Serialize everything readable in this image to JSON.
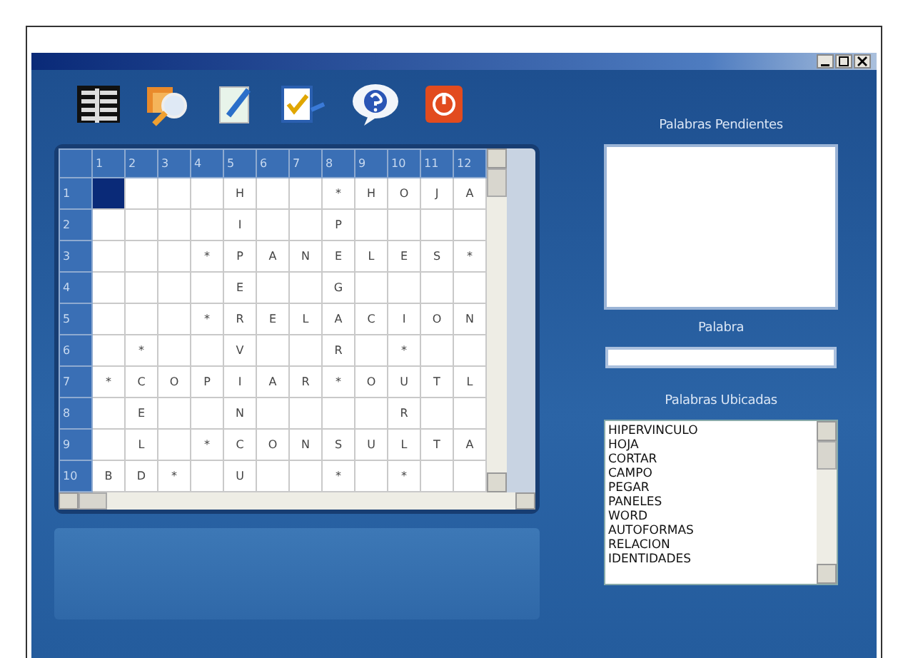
{
  "toolbar": [
    {
      "kind": "grid"
    },
    {
      "kind": "search"
    },
    {
      "kind": "edit"
    },
    {
      "kind": "check"
    },
    {
      "kind": "help"
    },
    {
      "kind": "power"
    }
  ],
  "grid": {
    "columns": [
      "1",
      "2",
      "3",
      "4",
      "5",
      "6",
      "7",
      "8",
      "9",
      "10",
      "11",
      "12"
    ],
    "rows": [
      {
        "header": "1",
        "cells": [
          {
            "text": "",
            "selected": true
          },
          {
            "text": "",
            "selected": false
          },
          {
            "text": "",
            "selected": false
          },
          {
            "text": "",
            "selected": false
          },
          {
            "text": "H",
            "selected": false
          },
          {
            "text": "",
            "selected": false
          },
          {
            "text": "",
            "selected": false
          },
          {
            "text": "*",
            "selected": false
          },
          {
            "text": "H",
            "selected": false
          },
          {
            "text": "O",
            "selected": false
          },
          {
            "text": "J",
            "selected": false
          },
          {
            "text": "A",
            "selected": false
          }
        ]
      },
      {
        "header": "2",
        "cells": [
          {
            "text": "",
            "selected": false
          },
          {
            "text": "",
            "selected": false
          },
          {
            "text": "",
            "selected": false
          },
          {
            "text": "",
            "selected": false
          },
          {
            "text": "I",
            "selected": false
          },
          {
            "text": "",
            "selected": false
          },
          {
            "text": "",
            "selected": false
          },
          {
            "text": "P",
            "selected": false
          },
          {
            "text": "",
            "selected": false
          },
          {
            "text": "",
            "selected": false
          },
          {
            "text": "",
            "selected": false
          },
          {
            "text": "",
            "selected": false
          }
        ]
      },
      {
        "header": "3",
        "cells": [
          {
            "text": "",
            "selected": false
          },
          {
            "text": "",
            "selected": false
          },
          {
            "text": "",
            "selected": false
          },
          {
            "text": "*",
            "selected": false
          },
          {
            "text": "P",
            "selected": false
          },
          {
            "text": "A",
            "selected": false
          },
          {
            "text": "N",
            "selected": false
          },
          {
            "text": "E",
            "selected": false
          },
          {
            "text": "L",
            "selected": false
          },
          {
            "text": "E",
            "selected": false
          },
          {
            "text": "S",
            "selected": false
          },
          {
            "text": "*",
            "selected": false
          }
        ]
      },
      {
        "header": "4",
        "cells": [
          {
            "text": "",
            "selected": false
          },
          {
            "text": "",
            "selected": false
          },
          {
            "text": "",
            "selected": false
          },
          {
            "text": "",
            "selected": false
          },
          {
            "text": "E",
            "selected": false
          },
          {
            "text": "",
            "selected": false
          },
          {
            "text": "",
            "selected": false
          },
          {
            "text": "G",
            "selected": false
          },
          {
            "text": "",
            "selected": false
          },
          {
            "text": "",
            "selected": false
          },
          {
            "text": "",
            "selected": false
          },
          {
            "text": "",
            "selected": false
          }
        ]
      },
      {
        "header": "5",
        "cells": [
          {
            "text": "",
            "selected": false
          },
          {
            "text": "",
            "selected": false
          },
          {
            "text": "",
            "selected": false
          },
          {
            "text": "*",
            "selected": false
          },
          {
            "text": "R",
            "selected": false
          },
          {
            "text": "E",
            "selected": false
          },
          {
            "text": "L",
            "selected": false
          },
          {
            "text": "A",
            "selected": false
          },
          {
            "text": "C",
            "selected": false
          },
          {
            "text": "I",
            "selected": false
          },
          {
            "text": "O",
            "selected": false
          },
          {
            "text": "N",
            "selected": false
          }
        ]
      },
      {
        "header": "6",
        "cells": [
          {
            "text": "",
            "selected": false
          },
          {
            "text": "*",
            "selected": false
          },
          {
            "text": "",
            "selected": false
          },
          {
            "text": "",
            "selected": false
          },
          {
            "text": "V",
            "selected": false
          },
          {
            "text": "",
            "selected": false
          },
          {
            "text": "",
            "selected": false
          },
          {
            "text": "R",
            "selected": false
          },
          {
            "text": "",
            "selected": false
          },
          {
            "text": "*",
            "selected": false
          },
          {
            "text": "",
            "selected": false
          },
          {
            "text": "",
            "selected": false
          }
        ]
      },
      {
        "header": "7",
        "cells": [
          {
            "text": "*",
            "selected": false
          },
          {
            "text": "C",
            "selected": false
          },
          {
            "text": "O",
            "selected": false
          },
          {
            "text": "P",
            "selected": false
          },
          {
            "text": "I",
            "selected": false
          },
          {
            "text": "A",
            "selected": false
          },
          {
            "text": "R",
            "selected": false
          },
          {
            "text": "*",
            "selected": false
          },
          {
            "text": "O",
            "selected": false
          },
          {
            "text": "U",
            "selected": false
          },
          {
            "text": "T",
            "selected": false
          },
          {
            "text": "L",
            "selected": false
          }
        ]
      },
      {
        "header": "8",
        "cells": [
          {
            "text": "",
            "selected": false
          },
          {
            "text": "E",
            "selected": false
          },
          {
            "text": "",
            "selected": false
          },
          {
            "text": "",
            "selected": false
          },
          {
            "text": "N",
            "selected": false
          },
          {
            "text": "",
            "selected": false
          },
          {
            "text": "",
            "selected": false
          },
          {
            "text": "",
            "selected": false
          },
          {
            "text": "",
            "selected": false
          },
          {
            "text": "R",
            "selected": false
          },
          {
            "text": "",
            "selected": false
          },
          {
            "text": "",
            "selected": false
          }
        ]
      },
      {
        "header": "9",
        "cells": [
          {
            "text": "",
            "selected": false
          },
          {
            "text": "L",
            "selected": false
          },
          {
            "text": "",
            "selected": false
          },
          {
            "text": "*",
            "selected": false
          },
          {
            "text": "C",
            "selected": false
          },
          {
            "text": "O",
            "selected": false
          },
          {
            "text": "N",
            "selected": false
          },
          {
            "text": "S",
            "selected": false
          },
          {
            "text": "U",
            "selected": false
          },
          {
            "text": "L",
            "selected": false
          },
          {
            "text": "T",
            "selected": false
          },
          {
            "text": "A",
            "selected": false
          }
        ]
      },
      {
        "header": "10",
        "cells": [
          {
            "text": "B",
            "selected": false
          },
          {
            "text": "D",
            "selected": false
          },
          {
            "text": "*",
            "selected": false
          },
          {
            "text": "",
            "selected": false
          },
          {
            "text": "U",
            "selected": false
          },
          {
            "text": "",
            "selected": false
          },
          {
            "text": "",
            "selected": false
          },
          {
            "text": "*",
            "selected": false
          },
          {
            "text": "",
            "selected": false
          },
          {
            "text": "*",
            "selected": false
          },
          {
            "text": "",
            "selected": false
          },
          {
            "text": "",
            "selected": false
          }
        ]
      }
    ]
  },
  "pending": {
    "label": "Palabras Pendientes"
  },
  "word": {
    "label": "Palabra"
  },
  "placed": {
    "label": "Palabras Ubicadas",
    "items": [
      "HIPERVINCULO",
      "HOJA",
      "CORTAR",
      "CAMPO",
      "PEGAR",
      "PANELES",
      "WORD",
      "AUTOFORMAS",
      "RELACION",
      "IDENTIDADES"
    ]
  }
}
